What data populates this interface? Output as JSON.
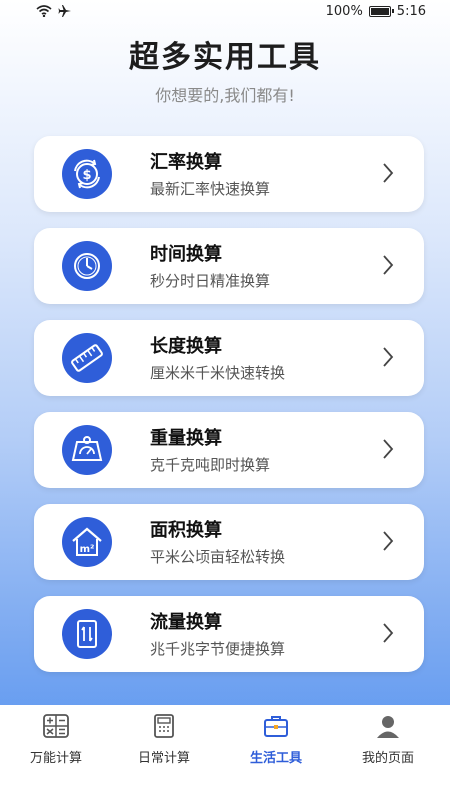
{
  "status": {
    "battery_text": "100%",
    "time": "5:16"
  },
  "header": {
    "title": "超多实用工具",
    "subtitle": "你想要的,我们都有!"
  },
  "tools": [
    {
      "title": "汇率换算",
      "desc": "最新汇率快速换算",
      "icon": "currency-exchange-icon"
    },
    {
      "title": "时间换算",
      "desc": "秒分时日精准换算",
      "icon": "clock-icon"
    },
    {
      "title": "长度换算",
      "desc": "厘米米千米快速转换",
      "icon": "ruler-icon"
    },
    {
      "title": "重量换算",
      "desc": "克千克吨即时换算",
      "icon": "scale-icon"
    },
    {
      "title": "面积换算",
      "desc": "平米公顷亩轻松转换",
      "icon": "house-area-icon"
    },
    {
      "title": "流量换算",
      "desc": "兆千兆字节便捷换算",
      "icon": "data-transfer-icon"
    }
  ],
  "tabs": [
    {
      "label": "万能计算",
      "icon": "calculator-grid-icon"
    },
    {
      "label": "日常计算",
      "icon": "calculator-icon"
    },
    {
      "label": "生活工具",
      "icon": "toolbox-icon",
      "active": true
    },
    {
      "label": "我的页面",
      "icon": "user-icon"
    }
  ],
  "colors": {
    "accent": "#2f5ed9",
    "title": "#1d1d1d",
    "subtitle": "#8a8a8a"
  }
}
